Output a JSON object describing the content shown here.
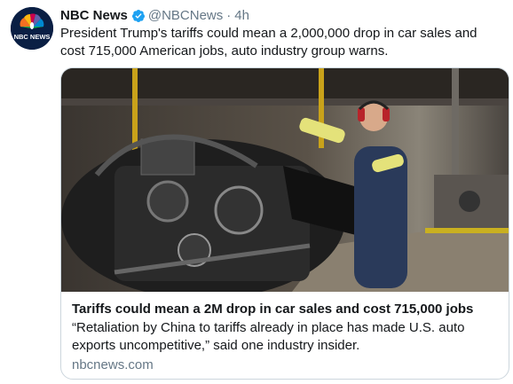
{
  "tweet": {
    "avatar_text": "NBC NEWS",
    "display_name": "NBC News",
    "verified_icon": "verified-badge-icon",
    "handle": "@NBCNews",
    "separator": "·",
    "time": "4h",
    "text": "President Trump's tariffs could mean a 2,000,000 drop in car sales and cost 715,000 American jobs, auto industry group warns."
  },
  "card": {
    "image_description": "assembly-line-photo",
    "title": "Tariffs could mean a 2M drop in car sales and cost 715,000 jobs",
    "description": "“Retaliation by China to tariffs already in place has made U.S. auto exports uncompetitive,” said one industry insider.",
    "domain": "nbcnews.com"
  },
  "colors": {
    "name": "#14171a",
    "meta": "#657786",
    "verified": "#1da1f2",
    "border": "#ccd6dd",
    "avatar_bg": "#0a1f44"
  }
}
